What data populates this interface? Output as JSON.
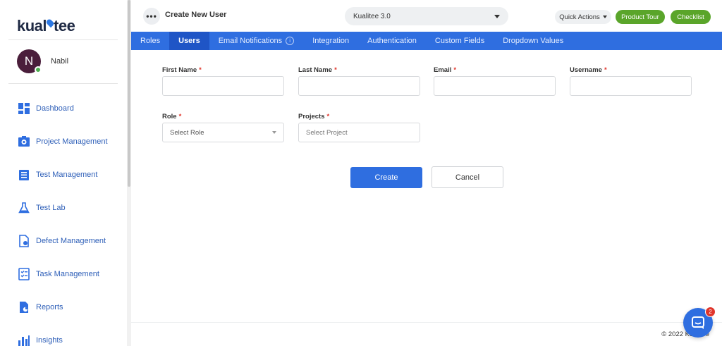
{
  "brand": {
    "logo_left": "kual",
    "logo_right": "tee"
  },
  "user": {
    "initial": "N",
    "name": "Nabil"
  },
  "sidebar": {
    "items": [
      {
        "label": "Dashboard",
        "icon": "dashboard-icon"
      },
      {
        "label": "Project Management",
        "icon": "project-management-icon"
      },
      {
        "label": "Test Management",
        "icon": "test-management-icon"
      },
      {
        "label": "Test Lab",
        "icon": "flask-icon"
      },
      {
        "label": "Defect Management",
        "icon": "defect-icon"
      },
      {
        "label": "Task Management",
        "icon": "task-icon"
      },
      {
        "label": "Reports",
        "icon": "reports-icon"
      },
      {
        "label": "Insights",
        "icon": "insights-icon"
      }
    ]
  },
  "topbar": {
    "menu_icon": "•••",
    "title": "Create New User",
    "project": "Kualitee 3.0",
    "quick_actions": "Quick Actions",
    "product_tour": "Product Tour",
    "checklist": "Checklist"
  },
  "tabs": [
    {
      "label": "Roles",
      "active": false
    },
    {
      "label": "Users",
      "active": true
    },
    {
      "label": "Email Notifications",
      "active": false,
      "badge": "i"
    },
    {
      "label": "Integration",
      "active": false
    },
    {
      "label": "Authentication",
      "active": false
    },
    {
      "label": "Custom Fields",
      "active": false
    },
    {
      "label": "Dropdown Values",
      "active": false
    }
  ],
  "form": {
    "first_name_label": "First Name",
    "last_name_label": "Last Name",
    "email_label": "Email",
    "username_label": "Username",
    "role_label": "Role",
    "role_value": "Select Role",
    "projects_label": "Projects",
    "projects_placeholder": "Select Project",
    "required": "*",
    "create": "Create",
    "cancel": "Cancel"
  },
  "footer": {
    "copyright": "© 2022 Kualitee"
  },
  "chat": {
    "badge": "2"
  },
  "colors": {
    "accent": "#2f6ee0",
    "tab_active": "#1f55c6",
    "green": "#5aa52a",
    "required": "#e0352b"
  }
}
